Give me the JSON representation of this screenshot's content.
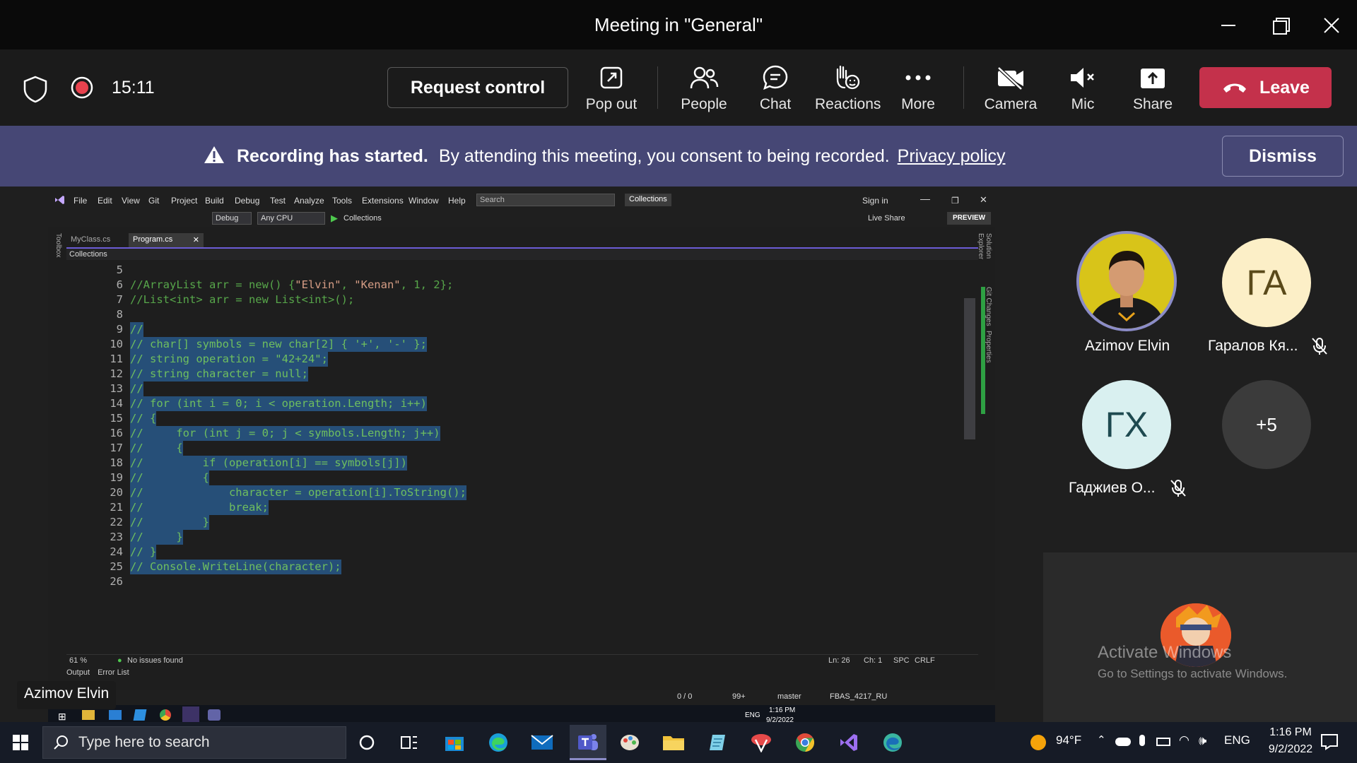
{
  "window": {
    "title": "Meeting in \"General\""
  },
  "toolbar": {
    "timer": "15:11",
    "request_control": "Request control",
    "pop_out": "Pop out",
    "people": "People",
    "chat": "Chat",
    "reactions": "Reactions",
    "more": "More",
    "camera": "Camera",
    "mic": "Mic",
    "share": "Share",
    "leave": "Leave"
  },
  "banner": {
    "title": "Recording has started.",
    "message": "By attending this meeting, you consent to being recorded.",
    "link": "Privacy policy",
    "dismiss": "Dismiss"
  },
  "vs": {
    "menu": [
      "File",
      "Edit",
      "View",
      "Git",
      "Project",
      "Build",
      "Debug",
      "Test",
      "Analyze",
      "Tools",
      "Extensions",
      "Window",
      "Help"
    ],
    "search_placeholder": "Search",
    "collections_badge": "Collections",
    "sign_in": "Sign in",
    "live_share": "Live Share",
    "preview": "PREVIEW",
    "config": "Debug",
    "platform": "Any CPU",
    "run_target": "Collections",
    "tabs": [
      "MyClass.cs",
      "Program.cs"
    ],
    "nav_project": "Collections",
    "side_tabs": [
      "Solution Explorer",
      "Git Changes",
      "Properties"
    ],
    "toolbox": "Toolbox",
    "zoom": "61 %",
    "issues": "No issues found",
    "ln": "Ln: 26",
    "ch": "Ch: 1",
    "spc": "SPC",
    "crlf": "CRLF",
    "bottom_tabs": [
      "Output",
      "Error List"
    ],
    "status": {
      "changes": "0 / 0",
      "edits": "99+",
      "branch": "master",
      "repo": "FBAS_4217_RU"
    },
    "inner_clock": {
      "time": "1:16 PM",
      "date": "9/2/2022",
      "lang": "ENG"
    }
  },
  "code": [
    {
      "n": "5",
      "text": "",
      "sel": false
    },
    {
      "n": "6",
      "text": "//ArrayList arr = new() {\"Elvin\", \"Kenan\", 1, 2};",
      "sel": false
    },
    {
      "n": "7",
      "text": "//List<int> arr = new List<int>();",
      "sel": false
    },
    {
      "n": "8",
      "text": "",
      "sel": false
    },
    {
      "n": "9",
      "text": "//",
      "sel": true
    },
    {
      "n": "10",
      "text": "// char[] symbols = new char[2] { '+', '-' };",
      "sel": true
    },
    {
      "n": "11",
      "text": "// string operation = \"42+24\";",
      "sel": true
    },
    {
      "n": "12",
      "text": "// string character = null;",
      "sel": true
    },
    {
      "n": "13",
      "text": "//",
      "sel": true
    },
    {
      "n": "14",
      "text": "// for (int i = 0; i < operation.Length; i++)",
      "sel": true
    },
    {
      "n": "15",
      "text": "// {",
      "sel": true
    },
    {
      "n": "16",
      "text": "//     for (int j = 0; j < symbols.Length; j++)",
      "sel": true
    },
    {
      "n": "17",
      "text": "//     {",
      "sel": true
    },
    {
      "n": "18",
      "text": "//         if (operation[i] == symbols[j])",
      "sel": true
    },
    {
      "n": "19",
      "text": "//         {",
      "sel": true
    },
    {
      "n": "20",
      "text": "//             character = operation[i].ToString();",
      "sel": true
    },
    {
      "n": "21",
      "text": "//             break;",
      "sel": true
    },
    {
      "n": "22",
      "text": "//         }",
      "sel": true
    },
    {
      "n": "23",
      "text": "//     }",
      "sel": true
    },
    {
      "n": "24",
      "text": "// }",
      "sel": true
    },
    {
      "n": "25",
      "text": "// Console.WriteLine(character);",
      "sel": true
    },
    {
      "n": "26",
      "text": "",
      "sel": false
    }
  ],
  "presenter_label": "Azimov Elvin",
  "participants": {
    "p1_name": "Azimov Elvin",
    "p2_initials": "ГА",
    "p2_name": "Гаралов Кя...",
    "p3_initials": "ГХ",
    "p3_name": "Гаджиев О...",
    "more": "+5"
  },
  "watermark": {
    "title": "Activate Windows",
    "subtitle": "Go to Settings to activate Windows."
  },
  "taskbar": {
    "search_placeholder": "Type here to search",
    "weather": "94°F",
    "lang": "ENG",
    "time": "1:16 PM",
    "date": "9/2/2022"
  },
  "colors": {
    "leave": "#c4314b",
    "banner": "#464775",
    "selection": "#264f78",
    "comment": "#57a64a",
    "recording": "#e8424e"
  }
}
